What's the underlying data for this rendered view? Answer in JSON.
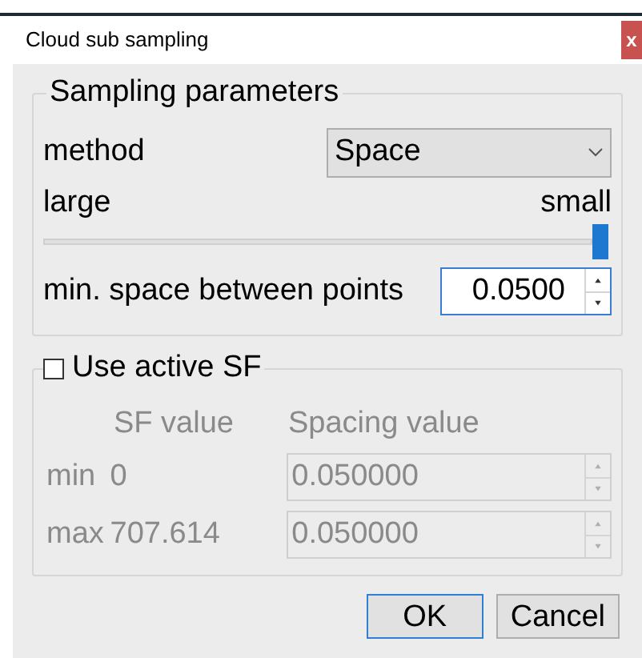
{
  "window": {
    "title": "Cloud sub sampling",
    "close": "x"
  },
  "sampling": {
    "title": "Sampling parameters",
    "method_label": "method",
    "method_value": "Space",
    "left_label": "large",
    "right_label": "small",
    "slider": {
      "level": 1
    },
    "spacing_label": "min. space between points",
    "spacing_value": "0.0500"
  },
  "sf": {
    "label": "Use active SF",
    "checked": false,
    "col_sf": "SF value",
    "col_spacing": "Spacing value",
    "rows": [
      {
        "label": "min",
        "sf_value": "0",
        "spacing": "0.050000"
      },
      {
        "label": "max",
        "sf_value": "707.614",
        "spacing": "0.050000"
      }
    ]
  },
  "buttons": [
    {
      "label": "OK",
      "default": true
    },
    {
      "label": "Cancel",
      "default": false
    }
  ]
}
